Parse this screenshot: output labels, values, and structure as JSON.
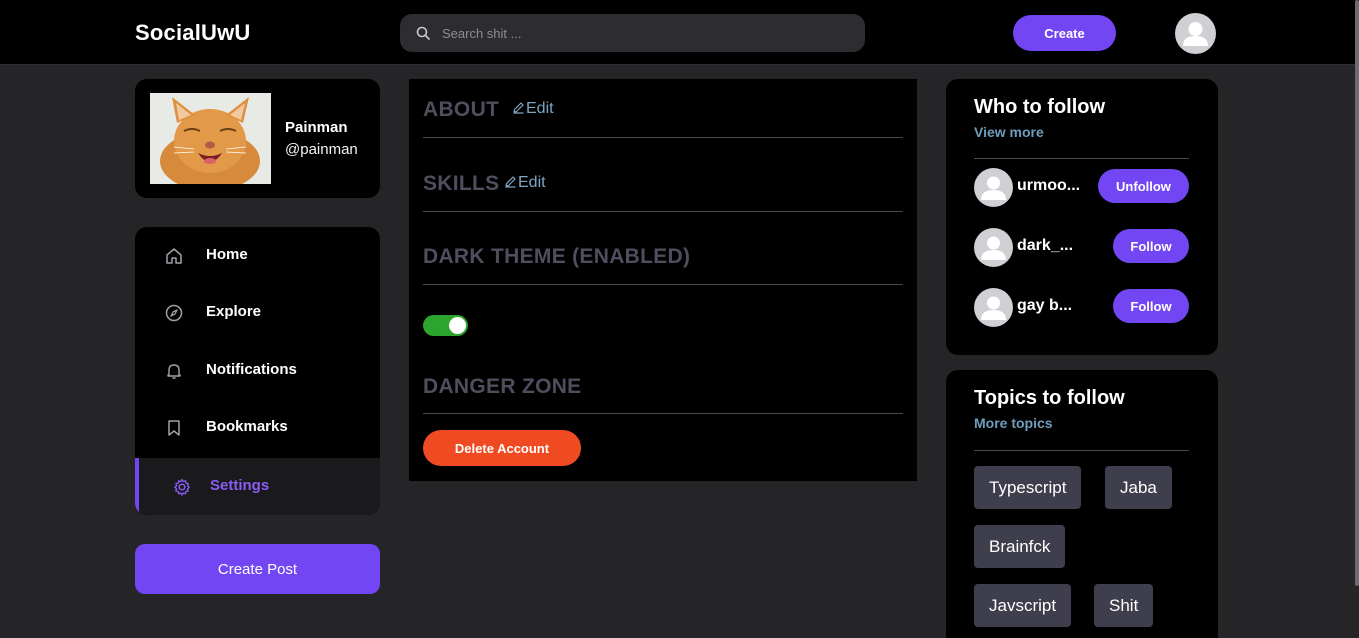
{
  "app": {
    "logo": "SocialUwU",
    "search_placeholder": "Search shit ...",
    "create_label": "Create"
  },
  "profile": {
    "name": "Painman",
    "handle": "@painman"
  },
  "nav": {
    "items": [
      {
        "label": "Home",
        "icon": "home-icon"
      },
      {
        "label": "Explore",
        "icon": "compass-icon"
      },
      {
        "label": "Notifications",
        "icon": "bell-icon"
      },
      {
        "label": "Bookmarks",
        "icon": "bookmark-icon"
      },
      {
        "label": "Settings",
        "icon": "gear-icon",
        "active": true
      }
    ],
    "create_post_label": "Create Post"
  },
  "settings": {
    "about_title": "ABOUT",
    "skills_title": "SKILLS",
    "edit_label": "Edit",
    "theme_title": "DARK THEME (ENABLED)",
    "dark_theme_enabled": true,
    "danger_title": "DANGER ZONE",
    "delete_label": "Delete Account"
  },
  "who_to_follow": {
    "title": "Who to follow",
    "view_more": "View more",
    "users": [
      {
        "name": "urmoo...",
        "action": "Unfollow"
      },
      {
        "name": "dark_...",
        "action": "Follow"
      },
      {
        "name": "gay b...",
        "action": "Follow"
      }
    ]
  },
  "topics": {
    "title": "Topics to follow",
    "more": "More topics",
    "items": [
      "Typescript",
      "Jaba",
      "Brainfck",
      "Javscript",
      "Shit"
    ]
  },
  "colors": {
    "accent": "#7247f3",
    "danger": "#f04a22",
    "toggle_on": "#2da52d",
    "link": "#6e9ebc"
  }
}
